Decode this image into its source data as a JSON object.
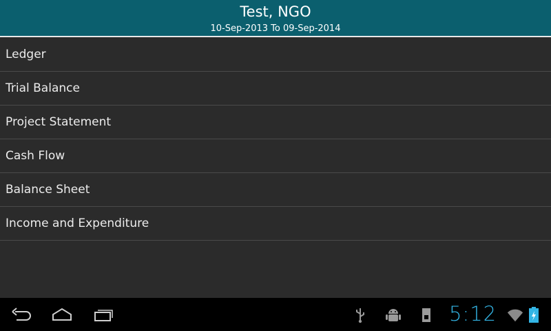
{
  "header": {
    "title": "Test, NGO",
    "subtitle": "10-Sep-2013 To 09-Sep-2014"
  },
  "menu": {
    "items": [
      {
        "label": "Ledger"
      },
      {
        "label": "Trial Balance"
      },
      {
        "label": "Project Statement"
      },
      {
        "label": "Cash Flow"
      },
      {
        "label": "Balance Sheet"
      },
      {
        "label": "Income and Expenditure"
      }
    ]
  },
  "system_bar": {
    "time": "5:12",
    "icons": [
      "back-icon",
      "home-icon",
      "recent-apps-icon",
      "usb-icon",
      "android-debug-icon",
      "sd-card-icon",
      "wifi-icon",
      "battery-charging-icon"
    ],
    "accent_color": "#33b5e5"
  },
  "colors": {
    "header_bg": "#0b5f6e",
    "list_bg": "#2b2b2b",
    "navbar_bg": "#000000"
  }
}
